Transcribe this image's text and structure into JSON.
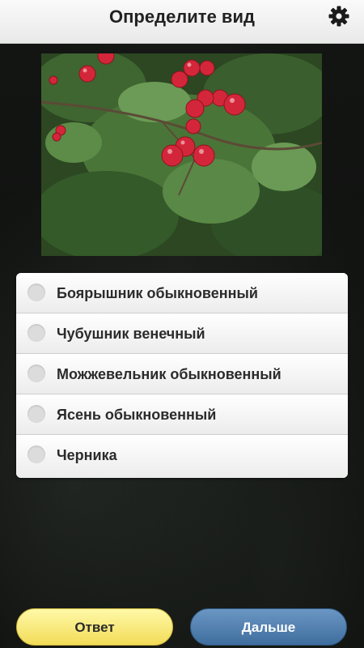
{
  "header": {
    "title": "Определите вид",
    "settings_icon": "gear-icon"
  },
  "photo": {
    "subject": "hawthorn-branch-with-red-berries"
  },
  "quiz": {
    "options": [
      {
        "label": "Боярышник обыкновенный"
      },
      {
        "label": "Чубушник венечный"
      },
      {
        "label": "Можжевельник обыкновенный"
      },
      {
        "label": "Ясень обыкновенный"
      },
      {
        "label": "Черника"
      }
    ]
  },
  "buttons": {
    "answer_label": "Ответ",
    "next_label": "Дальше"
  },
  "colors": {
    "answer_button": "#f2dc58",
    "next_button": "#4a79aa",
    "header_bg": "#f2f2f2"
  }
}
